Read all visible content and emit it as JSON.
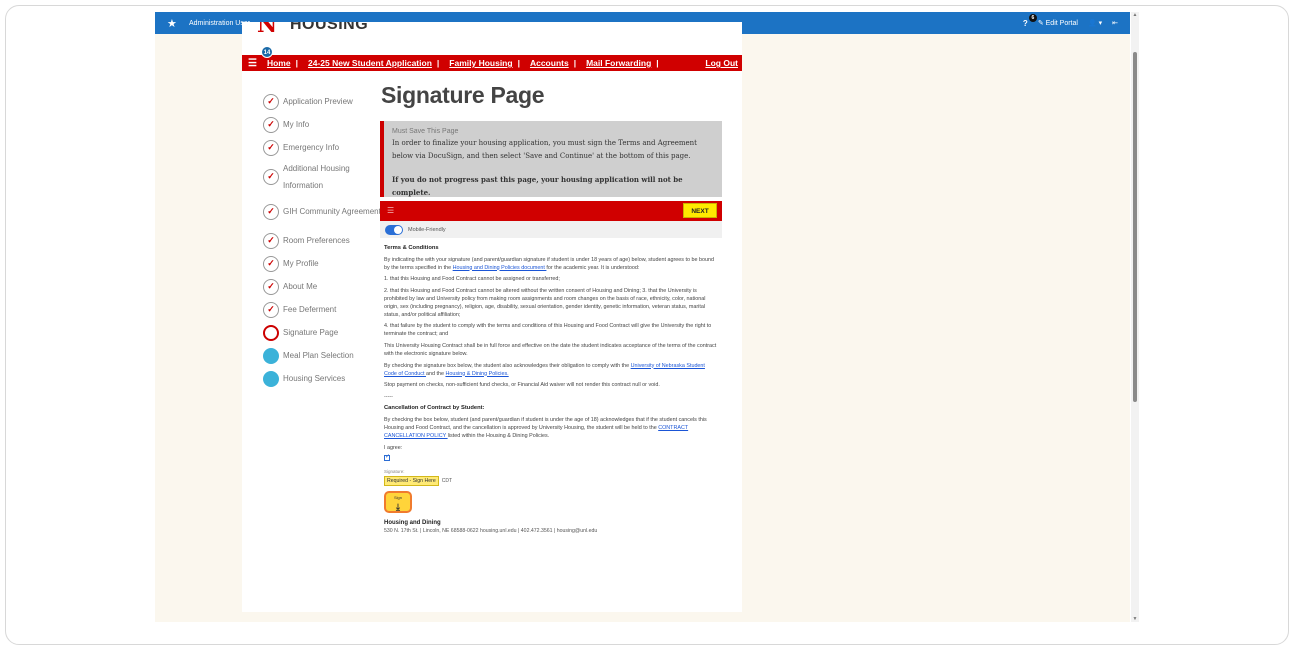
{
  "admin_bar": {
    "title": "Administration User",
    "help_count": "6",
    "help_label": "?",
    "edit_portal": "Edit Portal",
    "user_caret": "▾"
  },
  "logo": {
    "mark": "N",
    "text": "HOUSING PORTAL"
  },
  "nav": {
    "badge_count": "14",
    "links": [
      "Home",
      "24-25 New Student Application",
      "Family Housing",
      "Accounts",
      "Mail Forwarding"
    ],
    "separator": "|",
    "logout": "Log Out"
  },
  "steps": [
    {
      "label": "Application Preview",
      "state": "done"
    },
    {
      "label": "My Info",
      "state": "done"
    },
    {
      "label": "Emergency Info",
      "state": "done"
    },
    {
      "label": "Additional Housing Information",
      "state": "done"
    },
    {
      "label": "GIH Community Agreement",
      "state": "done"
    },
    {
      "label": "Room Preferences",
      "state": "done"
    },
    {
      "label": "My Profile",
      "state": "done"
    },
    {
      "label": "About Me",
      "state": "done"
    },
    {
      "label": "Fee Deferment",
      "state": "done"
    },
    {
      "label": "Signature Page",
      "state": "current"
    },
    {
      "label": "Meal Plan Selection",
      "state": "upcoming"
    },
    {
      "label": "Housing Services",
      "state": "upcoming"
    }
  ],
  "page_title": "Signature Page",
  "alert": {
    "heading": "Must Save This Page",
    "body": "In order to finalize your housing application, you must sign the Terms and Agreement below via DocuSign, and then select 'Save and Continue' at the bottom of this page.",
    "bold": "If you do not progress past this page, your housing application will not be complete."
  },
  "docusign": {
    "next": "NEXT",
    "mobile_label": "Mobile-Friendly"
  },
  "doc": {
    "terms_heading": "Terms & Conditions",
    "p1a": "By indicating the with your signature (and parent/guardian signature if student is under 18 years of age) below, student agrees to be bound by the terms specified in the ",
    "p1link": "Housing and Dining Policies document ",
    "p1b": "for the academic year. It is understood:",
    "p2": "1. that this Housing and Food Contract cannot be assigned or transferred;",
    "p3": "2. that this Housing and Food Contract cannot be altered without the written consent of Housing and Dining; 3. that the University is prohibited by law and University policy from making room assignments and room changes on the basis of race, ethnicity, color, national origin, sex (including pregnancy), religion, age, disability, sexual orientation, gender identity, genetic information, veteran status, marital status, and/or political affiliation;",
    "p4": "4. that failure by the student to comply with the terms and conditions of this Housing and Food Contract will give the University the right to terminate the contract; and",
    "p5": "This University Housing Contract shall be in full force and effective on the date the student indicates acceptance of the terms of the contract with the electronic signature below.",
    "p6a": "By checking the signature box below, the student also acknowledges their obligation to comply with the ",
    "p6link1": "University of Nebraska Student Code of Conduct ",
    "p6b": "and the ",
    "p6link2": "Housing & Dining Policies.",
    "p7": "Stop payment on checks, non-sufficient fund checks, or Financial Aid waiver will not render this contract null or void.",
    "dashes": "-----",
    "cancel_heading": "Cancellation of Contract by Student:",
    "p8a": "By checking the box below, student (and parent/guardian if student is under the age of 18) acknowledges that if the student cancels this Housing and Food Contract, and the cancellation is approved by University Housing, the student will be held to the ",
    "p8link": "CONTRACT CANCELLATION POLICY ",
    "p8b": "listed within the Housing & Dining Policies.",
    "agree": "I agree:",
    "sig_label": "Signature:",
    "required": "Required - Sign Here",
    "cdt": "CDT",
    "sign": "Sign",
    "footer_heading": "Housing and Dining",
    "footer_address": "530 N. 17th St. | Lincoln, NE 68588-0622 housing.unl.edu | 402.472.3561 | housing@unl.edu"
  }
}
